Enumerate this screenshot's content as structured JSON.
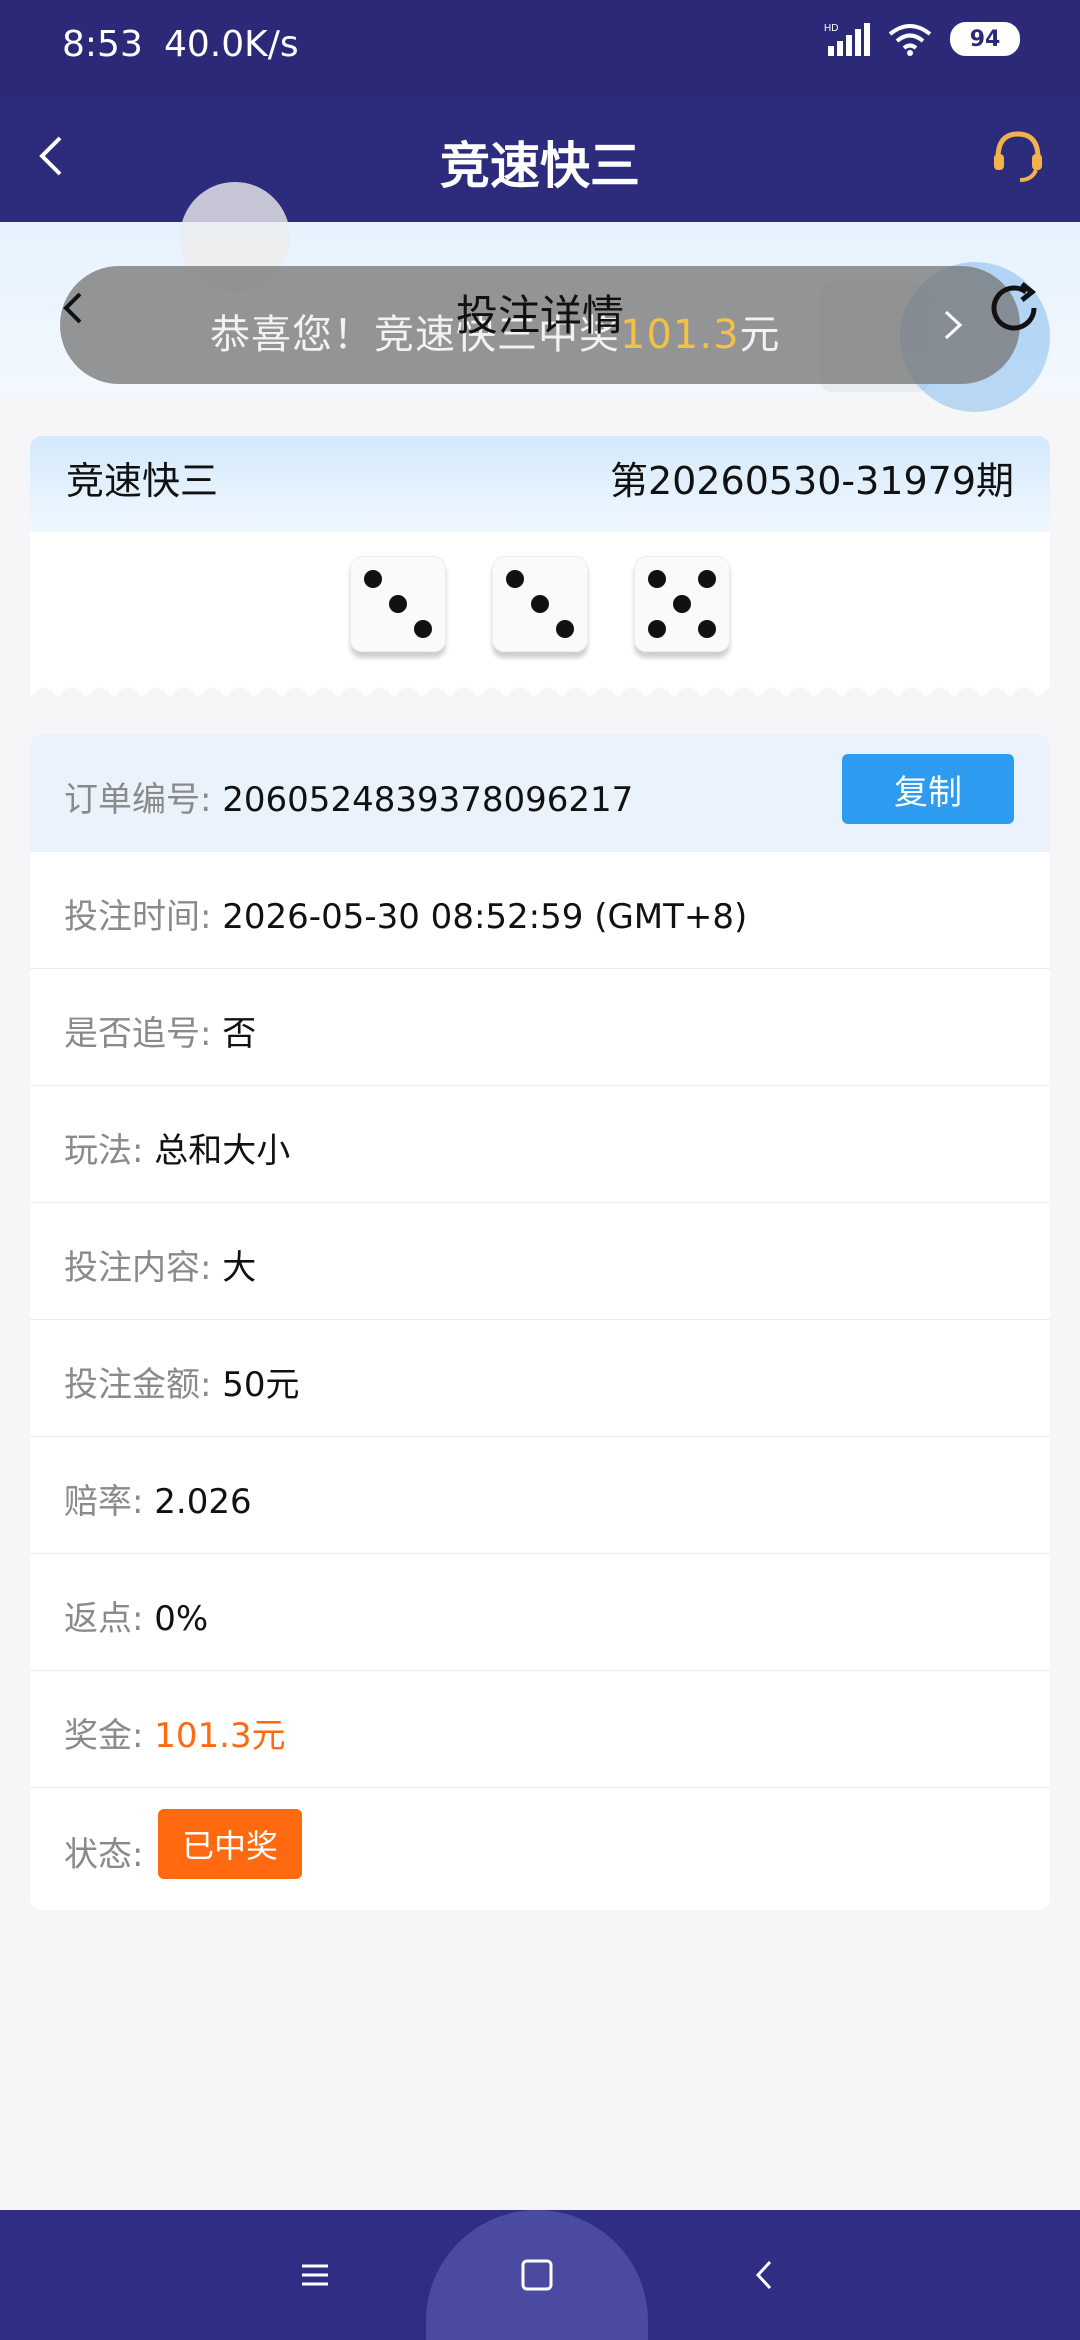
{
  "status_bar": {
    "time": "8:53",
    "speed": "40.0K/s",
    "battery": "94",
    "network": "HD"
  },
  "header": {
    "title": "竞速快三",
    "back_icon": "chevron-left-icon",
    "support_icon": "headset-icon"
  },
  "sub_header": {
    "title": "投注详情"
  },
  "toast": {
    "prefix": "恭喜您！竞速快三中奖",
    "amount": "101.3",
    "suffix": "元"
  },
  "draw": {
    "lottery": "竞速快三",
    "issue": "第20260530-31979期",
    "dice": [
      3,
      3,
      5
    ]
  },
  "order": {
    "id_label": "订单编号:",
    "id_value": "2060524839378096217",
    "copy_label": "复制",
    "rows": [
      {
        "label": "投注时间:",
        "value": "2026-05-30 08:52:59 (GMT+8)"
      },
      {
        "label": "是否追号:",
        "value": "否"
      },
      {
        "label": "玩法:",
        "value": "总和大小"
      },
      {
        "label": "投注内容:",
        "value": "大"
      },
      {
        "label": "投注金额:",
        "value": "50元"
      },
      {
        "label": "赔率:",
        "value": "2.026"
      },
      {
        "label": "返点:",
        "value": "0%"
      },
      {
        "label": "奖金:",
        "value": "101.3元"
      }
    ],
    "status_label": "状态:",
    "status_value": "已中奖"
  },
  "colors": {
    "header_bg": "#2d2b7c",
    "accent_blue": "#2c9bf0",
    "win_orange": "#ff6a10"
  }
}
